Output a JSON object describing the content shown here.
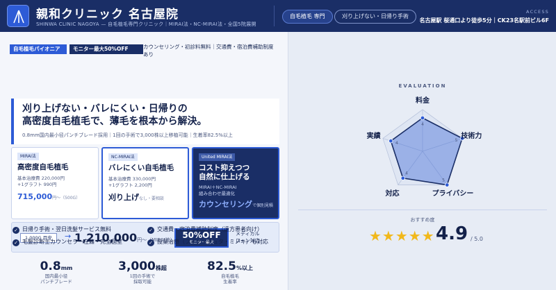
{
  "header": {
    "brand_name": "親和クリニック 名古屋院",
    "brand_sub": "SHINWA CLINIC NAGOYA — 自毛植毛専門クリニック｜MIRAI法・NC-MIRAI法・全国5院展開",
    "pill_primary": "自毛植毛 専門",
    "pill_secondary": "刈り上げない・日帰り手術",
    "access_label": "ACCESS",
    "access_text": "名古屋駅 桜通口より徒歩5分｜CK23名駅前ビル6F"
  },
  "badges": {
    "b1": "自毛植毛パイオニア",
    "b2": "モニター最大50%OFF",
    "note": "カウンセリング・初診料無料｜交通費・宿泊費補助制度あり"
  },
  "hero": {
    "title_line1": "刈り上げない・バレにくい・日帰りの",
    "title_line2": "高密度自毛植毛で、薄毛を根本から解決。",
    "sub": "0.8mm国内最小径パンチブレード採用｜1回の手術で3,000株以上移植可能｜生着率82.5%以上"
  },
  "cards": [
    {
      "tag": "MIRAI法",
      "title": "高密度自毛植毛",
      "line1": "基本治療費 220,000円",
      "line2": "+1グラフト 990円",
      "price": "715,000",
      "price_unit": "円〜（500G）"
    },
    {
      "tag": "NC-MIRAI法",
      "title": "バレにくい自毛植毛",
      "line1": "基本治療費 330,000円",
      "line2": "+1グラフト 2,200円",
      "highlight": "刈り上げ",
      "highlight_note": "なし・要相談"
    },
    {
      "tag": "United MIRAI法",
      "title_line1": "コスト抑えつつ",
      "title_line2": "自然に仕上げる",
      "line1": "MIRAI＋NC-MIRAI",
      "line2": "組み合わせ最適化",
      "highlight": "カウンセリング",
      "highlight_note": "で個別見積"
    }
  ],
  "price_bar": {
    "tag": "1,000G 目安",
    "arrow": "→",
    "price": "1,210,000",
    "price_unit": "円〜（MIRAI法）",
    "off_main": "50%OFF",
    "off_sub": "モニター最大",
    "note_line1": "メディカル",
    "note_line2": "ローン対応"
  },
  "features": [
    "日帰り手術・翌日洗髪サービス無料",
    "交通費・宿泊費補助制度（遠方患者向け）",
    "毛髪診断士カウンセラー在籍・完全個室",
    "投薬治療（フィナ・デュタ・ミノキ）も対応"
  ],
  "stats": [
    {
      "value": "0.8",
      "unit": "mm",
      "label1": "国内最小径",
      "label2": "パンチブレード"
    },
    {
      "value": "3,000",
      "unit": "株超",
      "label1": "1回の手術で",
      "label2": "採取可能"
    },
    {
      "value": "82.5",
      "unit": "%以上",
      "label1": "自毛植毛",
      "label2": "生着率"
    }
  ],
  "evaluation": {
    "label": "EVALUATION",
    "axes": [
      "料金",
      "技術力",
      "プライバシー",
      "対応",
      "実績"
    ],
    "scores": [
      4,
      5,
      5,
      4,
      4
    ],
    "max": 5
  },
  "recommend": {
    "label": "おすすめ度",
    "stars": "★★★★★",
    "score": "4.9",
    "max": "/ 5.0"
  },
  "colors": {
    "navy": "#1a2e66",
    "accent": "#2d5bd6",
    "star": "#f1b81b"
  }
}
